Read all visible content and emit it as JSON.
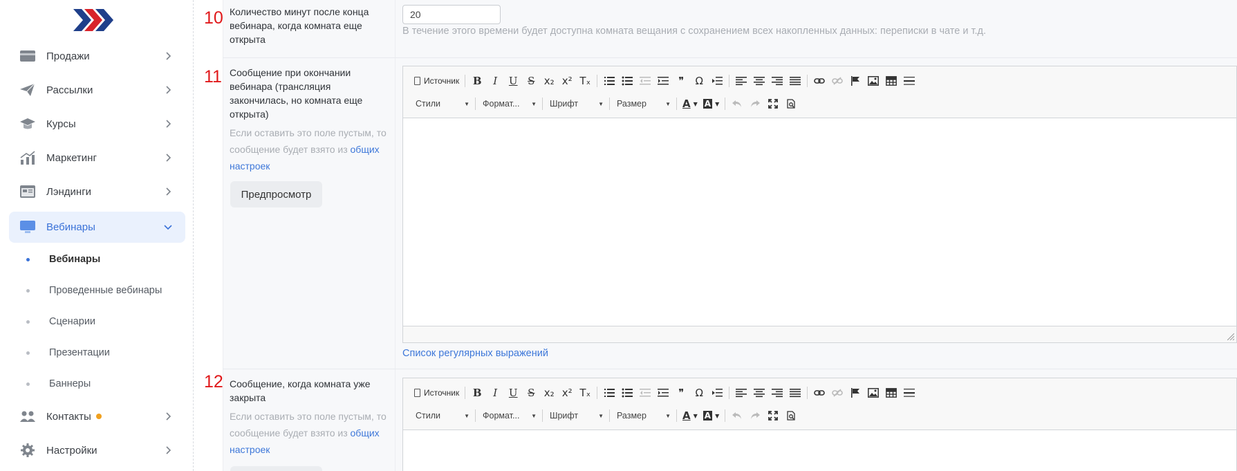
{
  "sidebar": {
    "logo": "logo",
    "items": [
      {
        "label": "Продажи",
        "icon": "wallet-icon"
      },
      {
        "label": "Рассылки",
        "icon": "paper-plane-icon"
      },
      {
        "label": "Курсы",
        "icon": "graduation-cap-icon"
      },
      {
        "label": "Маркетинг",
        "icon": "chart-icon"
      },
      {
        "label": "Лэндинги",
        "icon": "landing-page-icon"
      },
      {
        "label": "Вебинары",
        "icon": "monitor-icon"
      },
      {
        "label": "Контакты",
        "icon": "users-icon"
      },
      {
        "label": "Настройки",
        "icon": "gear-icon"
      }
    ],
    "subitems": [
      {
        "label": "Вебинары"
      },
      {
        "label": "Проведенные вебинары"
      },
      {
        "label": "Сценарии"
      },
      {
        "label": "Презентации"
      },
      {
        "label": "Баннеры"
      }
    ]
  },
  "rows": {
    "r10": {
      "num": "10",
      "label": "Количество минут после конца вебинара, когда комната еще открыта",
      "value": "20",
      "help": "В течение этого времени будет доступна комната вещания с сохранением всех накопленных данных: переписки в чате и т.д."
    },
    "r11": {
      "num": "11",
      "label": "Сообщение при окончании вебинара (трансляция закончилась, но комната еще открыта)",
      "hint": "Если оставить это поле пустым, то сообщение будет взято из",
      "hint_link": "общих настроек",
      "preview": "Предпросмотр",
      "regex_link": "Список регулярных выражений"
    },
    "r12": {
      "num": "12",
      "label": "Сообщение, когда комната уже закрыта",
      "hint": "Если оставить это поле пустым, то сообщение будет взято из",
      "hint_link": "общих настроек"
    }
  },
  "editor": {
    "source": "Источник",
    "styles": "Стили",
    "format": "Формат...",
    "font": "Шрифт",
    "size": "Размер",
    "bold": "B",
    "italic": "I",
    "underline": "U",
    "strike": "S",
    "sub": "x₂",
    "sup": "x²",
    "removefmt": "Tₓ",
    "quote": "❞",
    "omega": "Ω",
    "fontcolor": "A",
    "bgcolor": "A"
  },
  "colors": {
    "accent": "#3a72d8",
    "row_number": "#e0191b",
    "badge": "#f0a01e"
  }
}
